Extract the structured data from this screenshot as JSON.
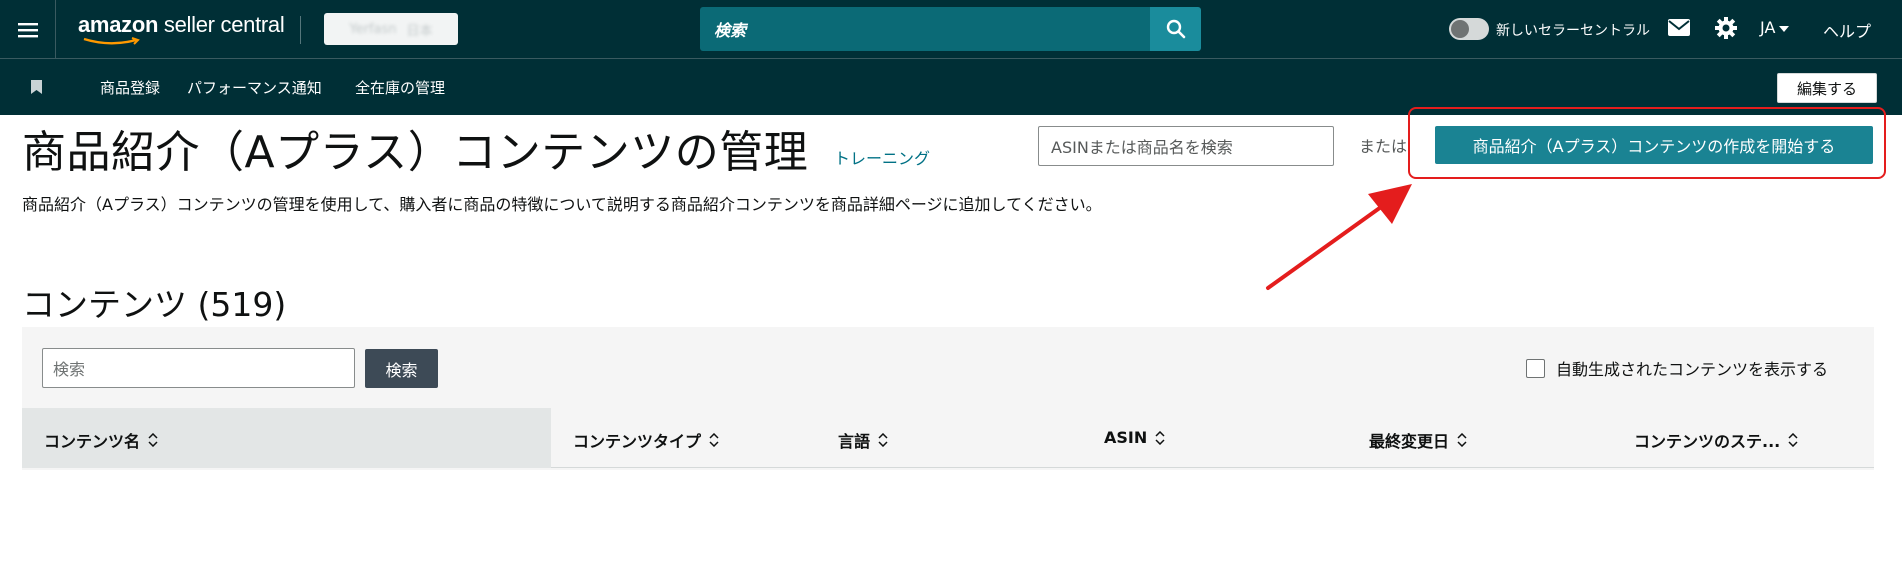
{
  "header": {
    "logo_bold": "amazon",
    "logo_rest": " seller central",
    "account_chip_left": "Yerfasn",
    "account_chip_right": "日本",
    "search_placeholder": "検索",
    "toggle_label": "新しいセラーセントラル",
    "language": "JA",
    "help": "ヘルプ"
  },
  "subnav": {
    "items": [
      "商品登録",
      "パフォーマンス通知",
      "全在庫の管理"
    ],
    "edit_label": "編集する"
  },
  "main": {
    "title": "商品紹介（Aプラス）コンテンツの管理",
    "training_link": "トレーニング",
    "asin_search_placeholder": "ASINまたは商品名を検索",
    "or_text": "または",
    "start_button": "商品紹介（Aプラス）コンテンツの作成を開始する",
    "description": "商品紹介（Aプラス）コンテンツの管理を使用して、購入者に商品の特徴について説明する商品紹介コンテンツを商品詳細ページに追加してください。"
  },
  "contents": {
    "section_title": "コンテンツ (519)",
    "filter_placeholder": "検索",
    "filter_button": "検索",
    "auto_generated_label": "自動生成されたコンテンツを表示する",
    "columns": [
      "コンテンツ名",
      "コンテンツタイプ",
      "言語",
      "ASIN",
      "最終変更日",
      "コンテンツのステ..."
    ]
  },
  "colors": {
    "header_bg": "#002f36",
    "accent": "#1a8393",
    "highlight": "#e41d1d"
  }
}
